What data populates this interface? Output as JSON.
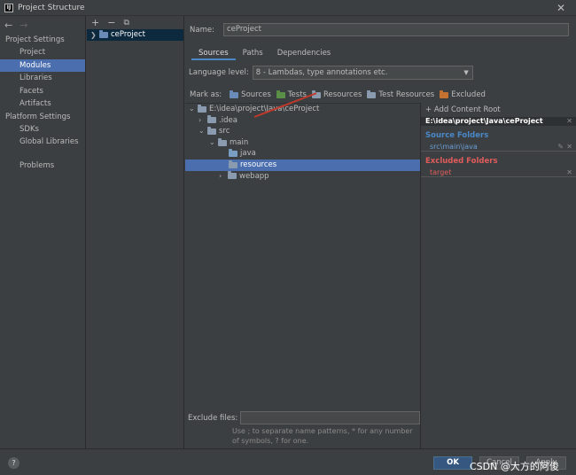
{
  "window": {
    "title": "Project Structure",
    "app_icon": "intellij-icon",
    "app_icon_text": "IJ"
  },
  "nav": {
    "back": "←",
    "forward": "→",
    "project_settings": "Project Settings",
    "project_items": [
      "Project",
      "Modules",
      "Libraries",
      "Facets",
      "Artifacts"
    ],
    "platform_settings": "Platform Settings",
    "platform_items": [
      "SDKs",
      "Global Libraries"
    ],
    "problems": "Problems",
    "selected": "Modules"
  },
  "modules": {
    "add": "+",
    "remove": "−",
    "copy": "⧉",
    "item": "ceProject"
  },
  "main": {
    "name_label": "Name:",
    "name_value": "ceProject",
    "tabs": [
      "Sources",
      "Paths",
      "Dependencies"
    ],
    "active_tab": "Sources",
    "language_label": "Language level:",
    "language_value": "8 - Lambdas, type annotations etc.",
    "mark_label": "Mark as:",
    "marks": [
      "Sources",
      "Tests",
      "Resources",
      "Test Resources",
      "Excluded"
    ],
    "tree": {
      "root": "E:\\idea\\project\\Java\\ceProject",
      "idea": ".idea",
      "src": "src",
      "main": "main",
      "java": "java",
      "resources": "resources",
      "webapp": "webapp"
    },
    "exclude_label": "Exclude files:",
    "exclude_value": "",
    "hint": "Use ; to separate name patterns, * for any number of symbols, ? for one."
  },
  "roots": {
    "add_content_root": "+ Add Content Root",
    "root_path": "E:\\idea\\project\\Java\\ceProject",
    "source_folders_title": "Source Folders",
    "source_folder": "src\\main\\java",
    "excluded_folders_title": "Excluded Folders",
    "excluded_folder": "target"
  },
  "buttons": {
    "help": "?",
    "ok": "OK",
    "cancel": "Cancel",
    "apply": "Apply"
  },
  "watermark": "CSDN @大方的阿俊"
}
